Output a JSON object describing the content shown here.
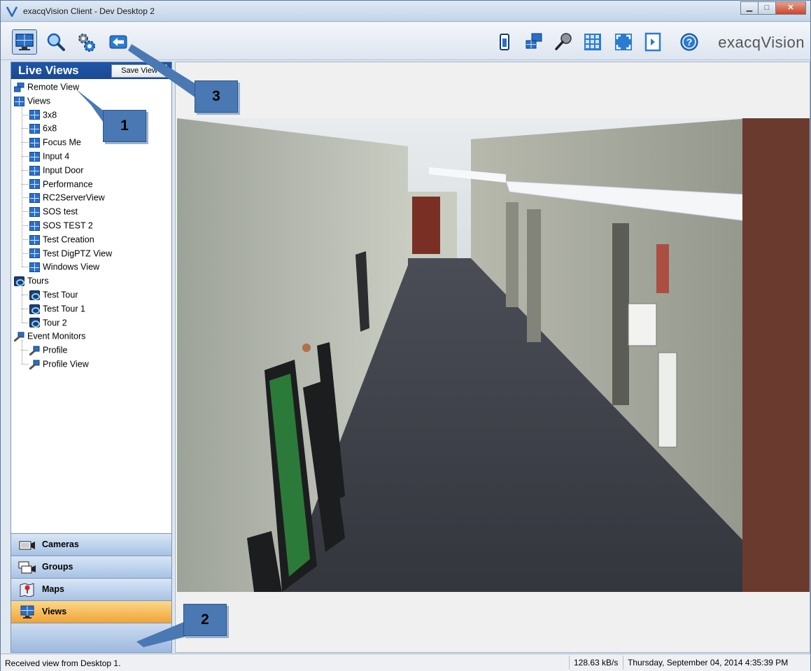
{
  "window": {
    "title": "exacqVision Client - Dev Desktop 2",
    "controls": [
      "minimize",
      "maximize",
      "close"
    ]
  },
  "toolbar": {
    "left_buttons": [
      "live-view-icon",
      "search-icon",
      "config-icon",
      "back-arrow-icon"
    ],
    "right_buttons": [
      "single-view-icon",
      "remote-view-icon",
      "audio-mic-icon",
      "grid-layout-icon",
      "fullscreen-icon",
      "expand-panel-icon",
      "help-icon"
    ],
    "brand": "exacqVision"
  },
  "left_panel": {
    "title": "Live Views",
    "save_button": "Save View",
    "tree": {
      "remote_view": "Remote View",
      "views_label": "Views",
      "views": [
        "3x8",
        "6x8",
        "Focus Me",
        "Input 4",
        "Input Door",
        "Performance",
        "RC2ServerView",
        "SOS test",
        "SOS TEST 2",
        "Test Creation",
        "Test DigPTZ View",
        "Windows View"
      ],
      "tours_label": "Tours",
      "tours": [
        "Test Tour",
        "Test Tour 1",
        "Tour 2"
      ],
      "event_monitors_label": "Event Monitors",
      "event_monitors": [
        "Profile",
        "Profile View"
      ]
    },
    "nav": [
      {
        "label": "Cameras",
        "icon": "camera-icon"
      },
      {
        "label": "Groups",
        "icon": "camera-group-icon"
      },
      {
        "label": "Maps",
        "icon": "map-icon"
      },
      {
        "label": "Views",
        "icon": "views-icon",
        "active": true
      }
    ]
  },
  "status": {
    "message": "Received view from Desktop 1.",
    "bandwidth": "128.63 kB/s",
    "datetime": "Thursday, September 04, 2014 4:35:39 PM"
  },
  "callouts": {
    "one": "1",
    "two": "2",
    "three": "3"
  },
  "colors": {
    "accent": "#1f56a8",
    "active_nav": "#f0a437",
    "callout": "#4a78b3"
  }
}
